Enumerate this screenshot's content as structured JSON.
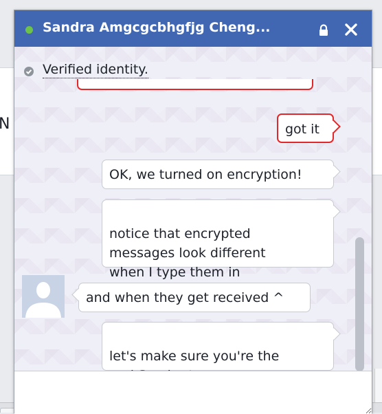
{
  "chat": {
    "title": "Sandra Amgcgcbhgfjg Cheng...",
    "verified_text": "Verified identity.",
    "messages": [
      {
        "text": "got it",
        "direction": "out",
        "highlighted": true
      },
      {
        "text": "OK, we turned on encryption!",
        "direction": "out",
        "highlighted": false
      },
      {
        "text": "notice that encrypted\nmessages look different\nwhen I type them in",
        "direction": "out",
        "highlighted": false
      },
      {
        "text": "and when they get received ^",
        "direction": "in",
        "highlighted": false
      },
      {
        "text": "let's make sure you're the\nreal Sandra too..",
        "direction": "out",
        "highlighted": false
      }
    ],
    "composer_value": "",
    "status": "online"
  },
  "background_page": {
    "visible_letter": "N"
  },
  "colors": {
    "titlebar": "#4267b2",
    "online": "#6cc24a",
    "highlight_border": "#e0272a",
    "verified_check": "#8e949c"
  },
  "icons": {
    "status": "online-dot-icon",
    "lock": "lock-icon",
    "close": "close-icon",
    "verified": "check-circle-icon",
    "avatar": "default-avatar-icon"
  }
}
